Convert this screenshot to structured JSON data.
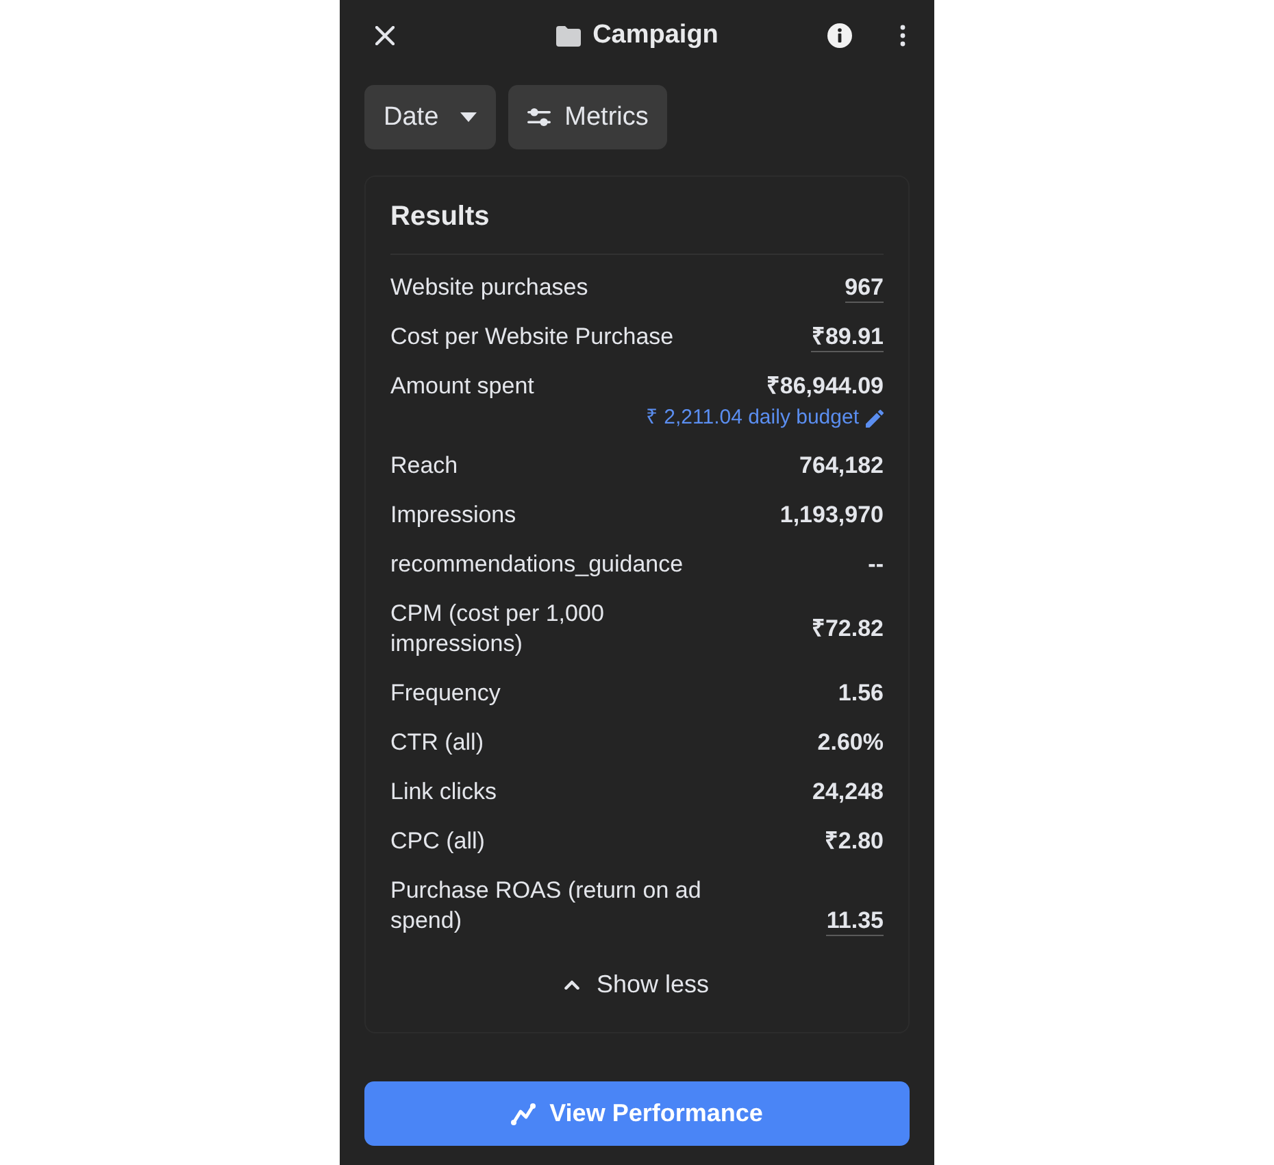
{
  "header": {
    "title": "Campaign"
  },
  "filters": [
    {
      "label": "Date",
      "kind": "dropdown"
    },
    {
      "label": "Metrics",
      "kind": "settings"
    }
  ],
  "results": {
    "title": "Results",
    "expanded": true,
    "toggle": "Show less",
    "metrics": [
      {
        "label": "Website purchases",
        "value": "967",
        "underlined": true
      },
      {
        "label": "Cost per Website Purchase",
        "value": "₹89.91",
        "underlined": true
      },
      {
        "label": "Amount spent",
        "value": "₹86,944.09",
        "underlined": false,
        "note": "₹ 2,211.04 daily budget"
      },
      {
        "label": "Reach",
        "value": "764,182",
        "underlined": false
      },
      {
        "label": "Impressions",
        "value": "1,193,970",
        "underlined": false
      },
      {
        "label": "recommendations_guidance",
        "value": "--",
        "underlined": false
      },
      {
        "label": "CPM (cost per 1,000 impressions)",
        "value": "₹72.82",
        "underlined": false
      },
      {
        "label": "Frequency",
        "value": "1.56",
        "underlined": false
      },
      {
        "label": "CTR (all)",
        "value": "2.60%",
        "underlined": false
      },
      {
        "label": "Link clicks",
        "value": "24,248",
        "underlined": false
      },
      {
        "label": "CPC (all)",
        "value": "₹2.80",
        "underlined": false
      },
      {
        "label": "Purchase ROAS (return on ad spend)",
        "value": "11.35",
        "underlined": true
      }
    ]
  },
  "primary_button": {
    "label": "View Performance"
  }
}
